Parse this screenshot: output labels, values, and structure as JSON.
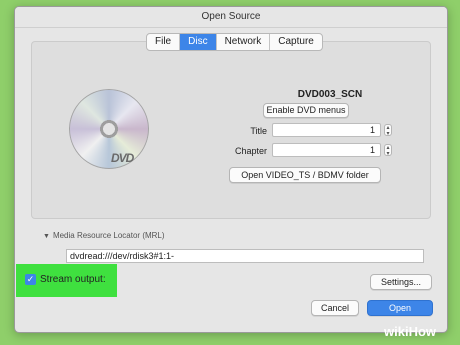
{
  "window": {
    "title": "Open Source"
  },
  "tabs": [
    {
      "label": "File",
      "active": false
    },
    {
      "label": "Disc",
      "active": true
    },
    {
      "label": "Network",
      "active": false
    },
    {
      "label": "Capture",
      "active": false
    }
  ],
  "disc": {
    "disc_name": "DVD003_SCN",
    "logo_text": "DVD",
    "enable_menus_label": "Enable DVD menus",
    "title_label": "Title",
    "title_value": "1",
    "chapter_label": "Chapter",
    "chapter_value": "1",
    "open_folder_label": "Open VIDEO_TS / BDMV folder"
  },
  "mrl": {
    "label": "Media Resource Locator (MRL)",
    "value": "dvdread:///dev/rdisk3#1:1-"
  },
  "stream_output": {
    "label": "Stream output:",
    "checked": true
  },
  "buttons": {
    "settings": "Settings...",
    "cancel": "Cancel",
    "open": "Open"
  },
  "watermark": {
    "wiki": "wiki",
    "how": "How"
  },
  "colors": {
    "accent": "#3d85e8",
    "highlight": "#3fe03f",
    "background": "#8fcf6a"
  },
  "icons": {
    "disc": "dvd-disc-icon",
    "disclosure": "disclosure-triangle-icon",
    "checkbox": "checkmark-icon"
  }
}
